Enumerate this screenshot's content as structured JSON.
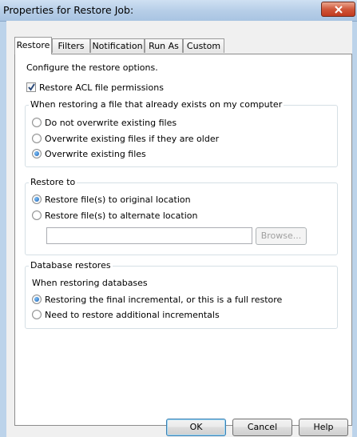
{
  "window": {
    "title": "Properties for Restore Job:"
  },
  "tabs": [
    {
      "label": "Restore",
      "active": true
    },
    {
      "label": "Filters"
    },
    {
      "label": "Notification"
    },
    {
      "label": "Run As"
    },
    {
      "label": "Custom"
    }
  ],
  "restore": {
    "description": "Configure the restore options.",
    "acl_label": "Restore ACL file permissions",
    "acl_checked": true,
    "existing_group": {
      "title": "When restoring a file that already exists on my computer",
      "options": [
        {
          "label": "Do not overwrite existing files",
          "checked": false
        },
        {
          "label": "Overwrite existing files if they are older",
          "checked": false
        },
        {
          "label": "Overwrite existing files",
          "checked": true
        }
      ]
    },
    "restore_to_group": {
      "title": "Restore to",
      "options": [
        {
          "label": "Restore file(s) to original location",
          "checked": true
        },
        {
          "label": "Restore file(s) to alternate location",
          "checked": false
        }
      ],
      "path_value": "",
      "browse_label": "Browse..."
    },
    "database_group": {
      "title": "Database restores",
      "subtitle": "When restoring databases",
      "options": [
        {
          "label": "Restoring the final incremental, or this is a full restore",
          "checked": true
        },
        {
          "label": "Need to restore additional incrementals",
          "checked": false
        }
      ]
    }
  },
  "footer": {
    "ok_label": "OK",
    "cancel_label": "Cancel",
    "help_label": "Help"
  }
}
